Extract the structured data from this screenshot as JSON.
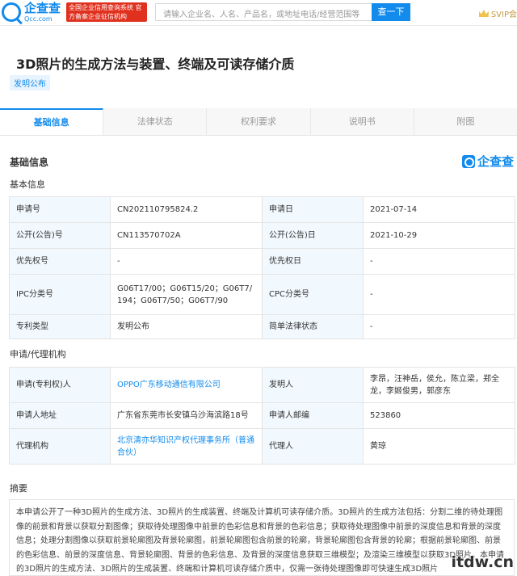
{
  "header": {
    "logo_cn": "企查查",
    "logo_en": "Qcc.com",
    "red_badge": "全国企业信用查询系统 官方备案企业征信机构",
    "search_placeholder": "请输入企业名、人名、产品名，或地址电话/经营范围等",
    "search_button": "查一下",
    "svip": "SVIP会"
  },
  "patent": {
    "title": "3D照片的生成方法与装置、终端及可读存储介质",
    "status_tag": "发明公布"
  },
  "tabs": [
    {
      "label": "基础信息"
    },
    {
      "label": "法律状态"
    },
    {
      "label": "权利要求"
    },
    {
      "label": "说明书"
    },
    {
      "label": "附图"
    }
  ],
  "section_basic": "基础信息",
  "brand": "企查查",
  "subsection_basic": "基本信息",
  "basic_rows": [
    {
      "l1": "申请号",
      "v1": "CN202110795824.2",
      "l2": "申请日",
      "v2": "2021-07-14"
    },
    {
      "l1": "公开(公告)号",
      "v1": "CN113570702A",
      "l2": "公开(公告)日",
      "v2": "2021-10-29"
    },
    {
      "l1": "优先权号",
      "v1": "-",
      "l2": "优先权日",
      "v2": "-"
    },
    {
      "l1": "IPC分类号",
      "v1": "G06T17/00；G06T15/20；G06T7/194；G06T7/50；G06T7/90",
      "l2": "CPC分类号",
      "v2": "-"
    },
    {
      "l1": "专利类型",
      "v1": "发明公布",
      "l2": "简单法律状态",
      "v2": "-"
    }
  ],
  "subsection_agency": "申请/代理机构",
  "agency_rows": [
    {
      "l1": "申请(专利权)人",
      "v1": "OPPO广东移动通信有限公司",
      "l2": "发明人",
      "v2": "李昂，汪神岳，侯允，陈立梁，郑全龙，李姬俊男，郭彦东"
    },
    {
      "l1": "申请人地址",
      "v1": "广东省东莞市长安镇乌沙海滨路18号",
      "l2": "申请人邮编",
      "v2": "523860"
    },
    {
      "l1": "代理机构",
      "v1": "北京清亦华知识产权代理事务所（普通合伙）",
      "l2": "代理人",
      "v2": "黄琼"
    }
  ],
  "subsection_abstract": "摘要",
  "abstract": "本申请公开了一种3D照片的生成方法、3D照片的生成装置、终端及计算机可读存储介质。3D照片的生成方法包括：分割二维的待处理图像的前景和背景以获取分割图像；获取待处理图像中前景的色彩信息和背景的色彩信息；获取待处理图像中前景的深度信息和背景的深度信息；处理分割图像以获取前景轮廓图及背景轮廓图，前景轮廓图包含前景的轮廓，背景轮廓图包含背景的轮廓；根据前景轮廓图、前景的色彩信息、前景的深度信息、背景轮廓图、背景的色彩信息、及背景的深度信息获取三维模型；及渲染三维模型以获取3D照片。本申请的3D照片的生成方法、3D照片的生成装置、终端和计算机可读存储介质中，仅需一张待处理图像即可快速生成3D照片",
  "watermark": "itdw.cn"
}
